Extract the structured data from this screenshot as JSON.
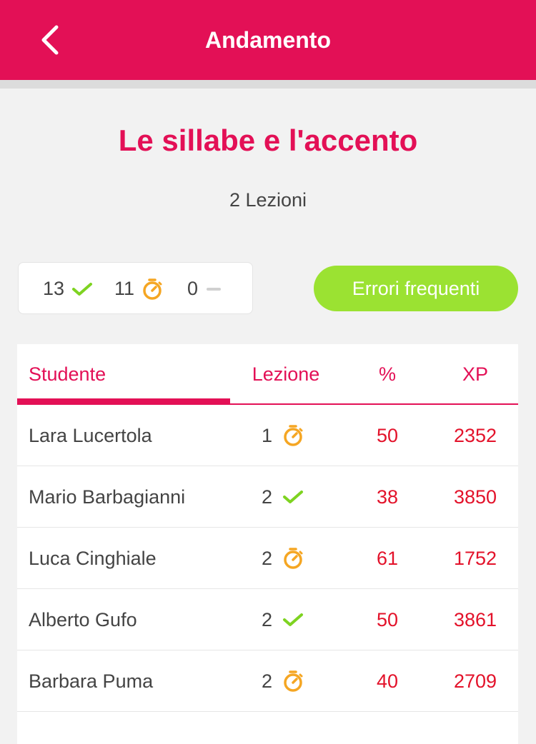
{
  "header": {
    "title": "Andamento",
    "back_icon": "chevron-left-icon"
  },
  "lesson": {
    "title": "Le sillabe e l'accento",
    "subtitle": "2 Lezioni"
  },
  "stats": {
    "completed": "13",
    "in_progress": "11",
    "not_started": "0"
  },
  "errors_button": {
    "label": "Errori frequenti"
  },
  "table": {
    "columns": [
      "Studente",
      "Lezione",
      "%",
      "XP"
    ],
    "active_tab": "Studente",
    "rows": [
      {
        "name": "Lara Lucertola",
        "lesson": "1",
        "status": "in-progress",
        "percent": "50",
        "xp": "2352"
      },
      {
        "name": "Mario Barbagianni",
        "lesson": "2",
        "status": "completed",
        "percent": "38",
        "xp": "3850"
      },
      {
        "name": "Luca Cinghiale",
        "lesson": "2",
        "status": "in-progress",
        "percent": "61",
        "xp": "1752"
      },
      {
        "name": "Alberto Gufo",
        "lesson": "2",
        "status": "completed",
        "percent": "50",
        "xp": "3861"
      },
      {
        "name": "Barbara Puma",
        "lesson": "2",
        "status": "in-progress",
        "percent": "40",
        "xp": "2709"
      }
    ]
  },
  "colors": {
    "brand": "#e31056",
    "accent_green": "#9be232",
    "check_green": "#7ed321",
    "timer_orange": "#f5a623",
    "value_red": "#e3122a"
  }
}
